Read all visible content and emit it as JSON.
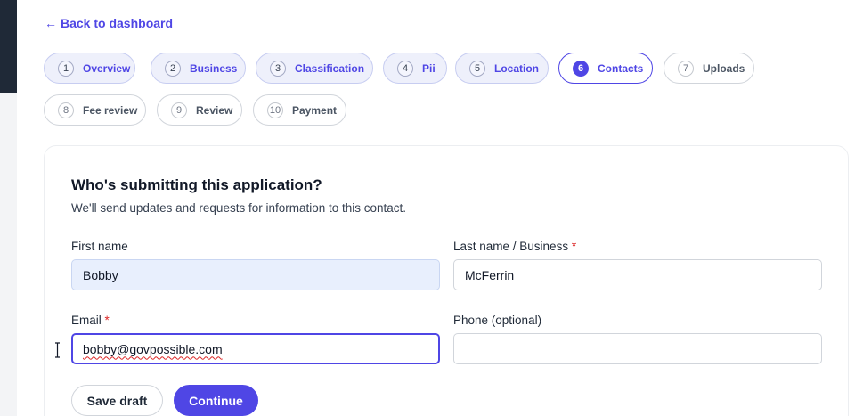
{
  "nav": {
    "back_label": "Back to dashboard"
  },
  "steps": [
    {
      "number": "1",
      "label": "Overview",
      "state": "done"
    },
    {
      "number": "2",
      "label": "Business",
      "state": "done"
    },
    {
      "number": "3",
      "label": "Classification",
      "state": "done"
    },
    {
      "number": "4",
      "label": "Pii",
      "state": "done"
    },
    {
      "number": "5",
      "label": "Location",
      "state": "done"
    },
    {
      "number": "6",
      "label": "Contacts",
      "state": "active"
    },
    {
      "number": "7",
      "label": "Uploads",
      "state": "todo"
    },
    {
      "number": "8",
      "label": "Fee review",
      "state": "todo"
    },
    {
      "number": "9",
      "label": "Review",
      "state": "todo"
    },
    {
      "number": "10",
      "label": "Payment",
      "state": "todo"
    }
  ],
  "form": {
    "title": "Who's submitting this application?",
    "subtitle": "We'll send updates and requests for information to this contact.",
    "first_name": {
      "label": "First name",
      "value": "Bobby"
    },
    "last_name": {
      "label": "Last name / Business",
      "required_mark": "*",
      "value": "McFerrin"
    },
    "email": {
      "label": "Email",
      "required_mark": "*",
      "value": "bobby@govpossible.com"
    },
    "phone": {
      "label": "Phone (optional)",
      "value": ""
    }
  },
  "actions": {
    "save_draft": "Save draft",
    "continue": "Continue"
  },
  "colors": {
    "accent": "#4f46e5",
    "required": "#dc2626",
    "sidebar": "#1f2937"
  }
}
